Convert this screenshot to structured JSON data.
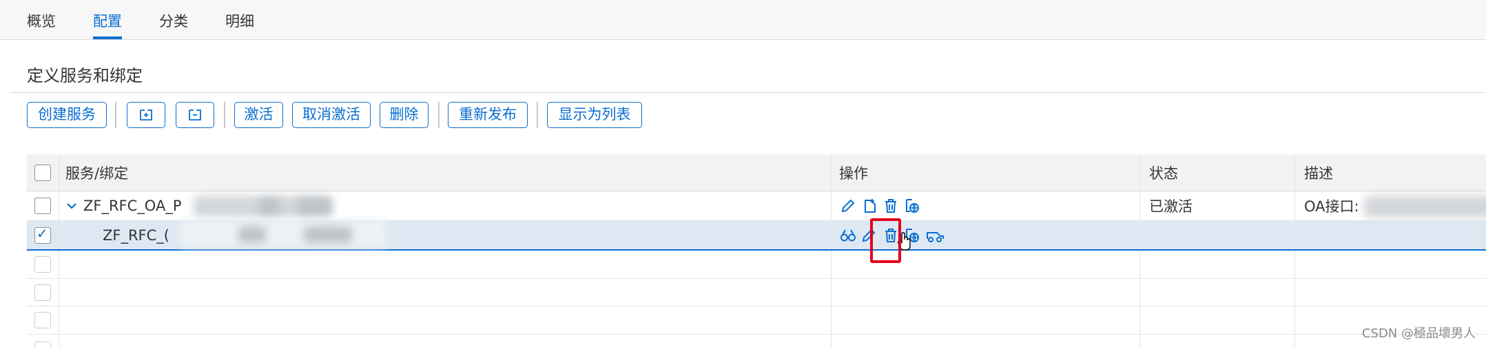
{
  "tabs": [
    {
      "label": "概览",
      "active": false
    },
    {
      "label": "配置",
      "active": true
    },
    {
      "label": "分类",
      "active": false
    },
    {
      "label": "明细",
      "active": false
    }
  ],
  "section": {
    "title": "定义服务和绑定"
  },
  "toolbar": {
    "create_service": "创建服务",
    "expand_icon": "expand-all-icon",
    "collapse_icon": "collapse-all-icon",
    "activate": "激活",
    "deactivate": "取消激活",
    "delete": "删除",
    "republish": "重新发布",
    "show_as_list": "显示为列表"
  },
  "table": {
    "columns": [
      "服务/绑定",
      "操作",
      "状态",
      "描述"
    ],
    "rows": [
      {
        "name": "ZF_RFC_OA_P",
        "expanded": true,
        "status": "已激活",
        "description": "OA接口:",
        "actions": [
          "edit-icon",
          "add-binding-icon",
          "delete-icon",
          "publish-icon"
        ],
        "selected": false
      },
      {
        "name": "ZF_RFC_(",
        "status": "",
        "description": "",
        "actions": [
          "display-icon",
          "edit-icon",
          "delete-icon",
          "publish-icon",
          "test-icon"
        ],
        "selected": true
      }
    ],
    "empty_rows": 3
  },
  "colors": {
    "accent": "#0a6ed1",
    "highlight": "#e3001b",
    "selected_row": "#dde8f3"
  },
  "watermark": "CSDN @極品壞男人"
}
